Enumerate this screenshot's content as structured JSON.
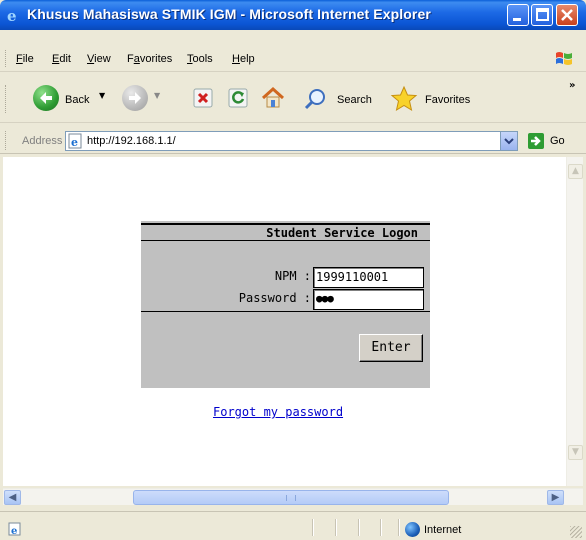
{
  "window": {
    "title": "Khusus Mahasiswa STMIK IGM - Microsoft Internet Explorer"
  },
  "menu": {
    "items": [
      {
        "label": "File",
        "underline": "F"
      },
      {
        "label": "Edit",
        "underline": "E"
      },
      {
        "label": "View",
        "underline": "V"
      },
      {
        "label": "Favorites",
        "underline": "a"
      },
      {
        "label": "Tools",
        "underline": "T"
      },
      {
        "label": "Help",
        "underline": "H"
      }
    ]
  },
  "toolbar": {
    "back_label": "Back",
    "search_label": "Search",
    "favorites_label": "Favorites",
    "overflow": "»"
  },
  "address": {
    "label": "Address",
    "url": "http://192.168.1.1/",
    "go_label": "Go"
  },
  "login": {
    "title": "Student Service Logon",
    "npm_label": "NPM :",
    "npm_value": "1999110001",
    "password_label": "Password :",
    "password_value": "●●●",
    "enter_label": "Enter",
    "forgot_link": "Forgot my password"
  },
  "status": {
    "zone": "Internet"
  },
  "colors": {
    "titlebar": "#0b55d4",
    "chrome": "#ece9d8",
    "login_panel": "#c0c0c0",
    "link": "#0000cc"
  }
}
